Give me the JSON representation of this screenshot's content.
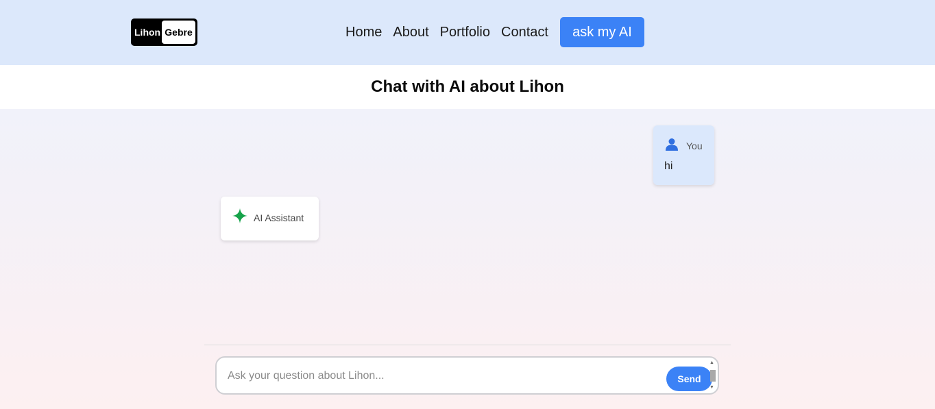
{
  "header": {
    "logo": {
      "left": "Lihon",
      "right": "Gebre"
    },
    "nav": [
      {
        "label": "Home"
      },
      {
        "label": "About"
      },
      {
        "label": "Portfolio"
      },
      {
        "label": "Contact"
      }
    ],
    "cta_label": "ask my AI"
  },
  "page_title": "Chat with AI about Lihon",
  "messages": [
    {
      "sender": "You",
      "text": "hi",
      "icon": "user-icon"
    },
    {
      "sender": "AI Assistant",
      "text": "",
      "icon": "sparkle-icon"
    }
  ],
  "composer": {
    "placeholder": "Ask your question about Lihon...",
    "value": "",
    "send_label": "Send"
  },
  "colors": {
    "accent": "#3b82f6",
    "header_bg": "#dce8fb",
    "user_bubble": "#dbe8fc",
    "ai_sparkle": "#16a34a"
  }
}
